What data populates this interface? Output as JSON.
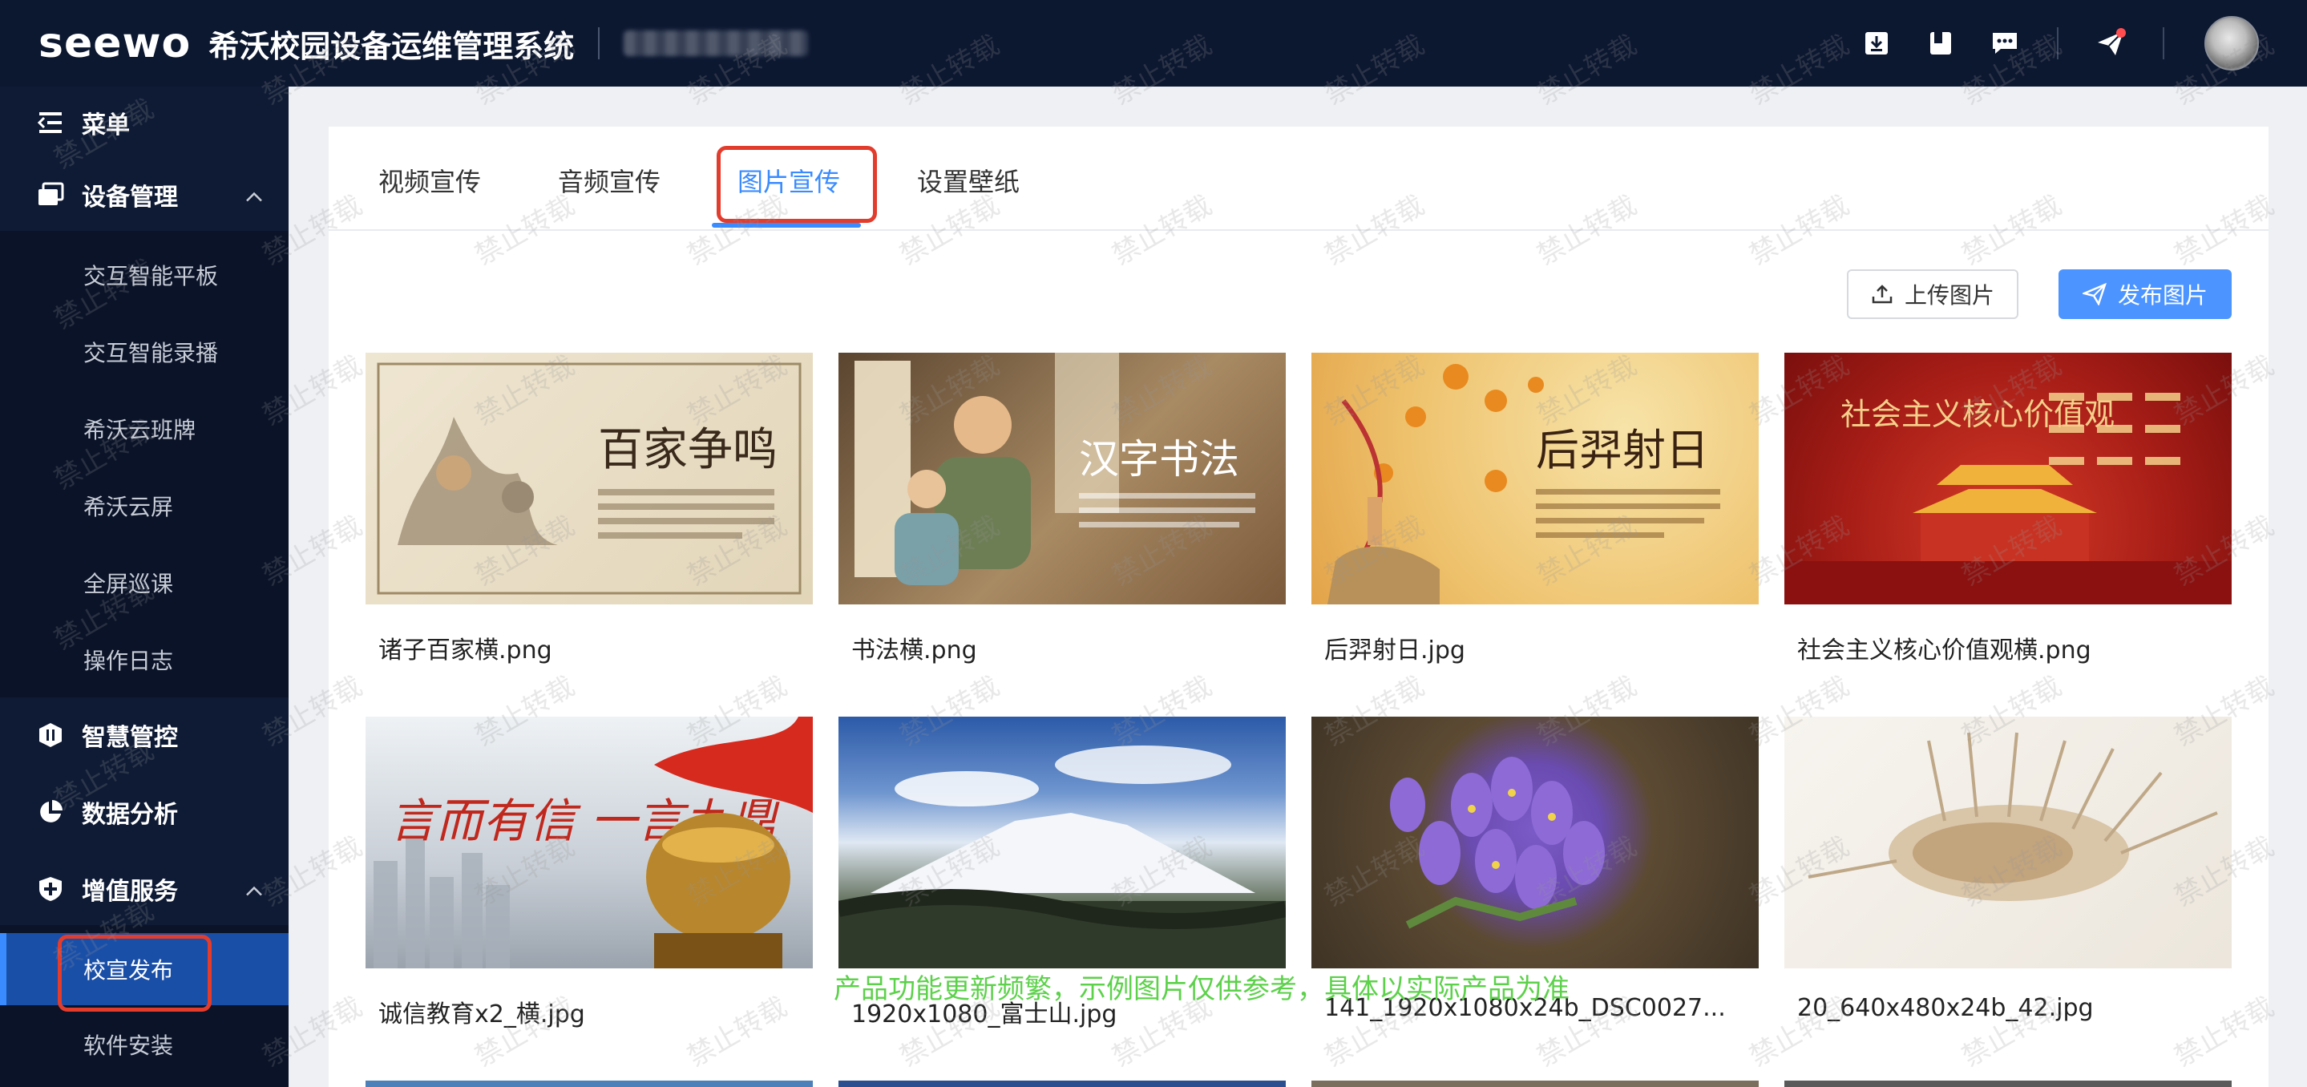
{
  "header": {
    "logo": "seewo",
    "title": "希沃校园设备运维管理系统"
  },
  "top_icons": [
    "download-icon",
    "book-icon",
    "message-icon",
    "send-icon"
  ],
  "sidebar": {
    "menu_label": "菜单",
    "groups": [
      {
        "label": "设备管理",
        "icon": "device-icon",
        "expanded": true,
        "items": [
          "交互智能平板",
          "交互智能录播",
          "希沃云班牌",
          "希沃云屏",
          "全屏巡课",
          "操作日志"
        ]
      },
      {
        "label": "智慧管控",
        "icon": "control-icon",
        "expanded": false,
        "items": []
      },
      {
        "label": "数据分析",
        "icon": "pie-icon",
        "expanded": false,
        "items": []
      },
      {
        "label": "增值服务",
        "icon": "plus-shield-icon",
        "expanded": true,
        "items": [
          "校宣发布",
          "软件安装"
        ]
      }
    ],
    "active_item": "校宣发布"
  },
  "tabs": [
    "视频宣传",
    "音频宣传",
    "图片宣传",
    "设置壁纸"
  ],
  "active_tab": "图片宣传",
  "toolbar": {
    "upload_label": "上传图片",
    "publish_label": "发布图片"
  },
  "images": [
    {
      "name": "诸子百家横.png",
      "overlay": "百家争鸣"
    },
    {
      "name": "书法横.png",
      "overlay": "汉字书法"
    },
    {
      "name": "后羿射日.jpg",
      "overlay": "后羿射日"
    },
    {
      "name": "社会主义核心价值观横.png",
      "overlay": "社会主义核心价值观"
    },
    {
      "name": "诚信教育x2_横.jpg",
      "overlay": "言而有信 一言九鼎"
    },
    {
      "name": "1920x1080_富士山.jpg",
      "overlay": ""
    },
    {
      "name": "141_1920x1080x24b_DSC0027...",
      "overlay": ""
    },
    {
      "name": "20_640x480x24b_42.jpg",
      "overlay": ""
    }
  ],
  "watermark_text": "禁止转载",
  "notice": "产品功能更新频繁，示例图片仅供参考，具体以实际产品为准",
  "colors": {
    "header_bg": "#0c1730",
    "sidebar_bg": "#0f1b35",
    "accent": "#3a8bff",
    "highlight": "#e23c2d",
    "notice": "#5cd14a"
  }
}
